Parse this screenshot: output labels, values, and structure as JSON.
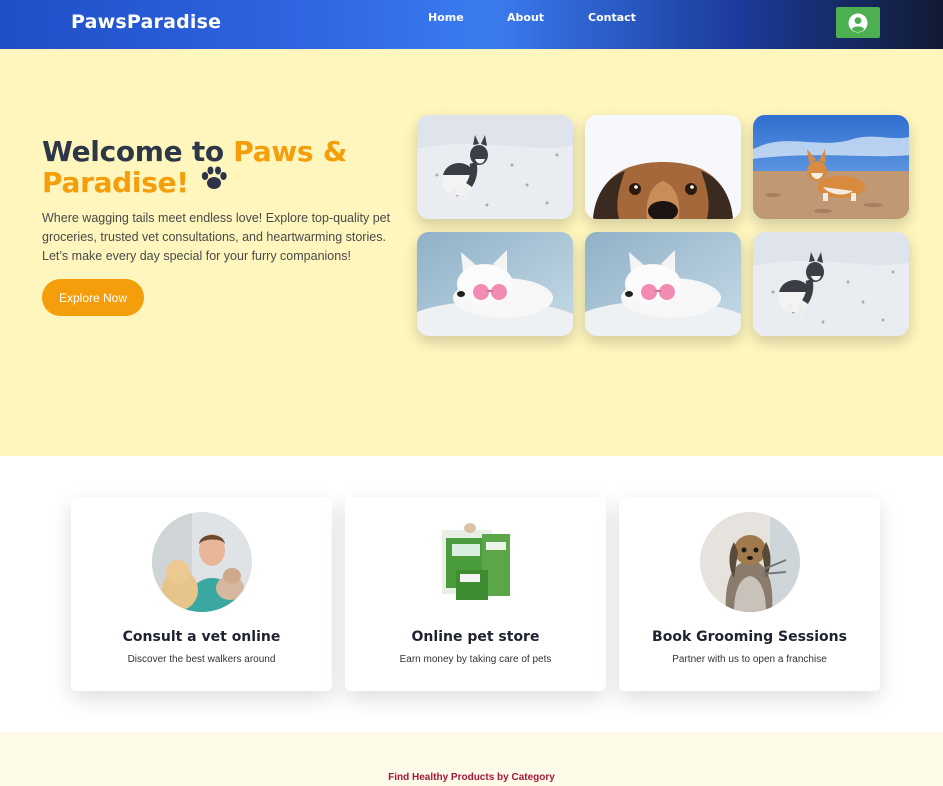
{
  "navbar": {
    "brand": "PawsParadise",
    "links": [
      "Home",
      "About",
      "Contact"
    ],
    "profile_icon": "user-circle-icon",
    "profile_color": "#4caf50"
  },
  "hero": {
    "title_prefix": "Welcome to ",
    "title_accent": "Paws & Paradise!",
    "title_icon": "paw-icon",
    "accent_color": "#f59e0b",
    "description": "Where wagging tails meet endless love! Explore top-quality pet groceries, trusted vet consultations, and heartwarming stories. Let’s make every day special for your furry companions!",
    "cta_label": "Explore Now",
    "background": "#fef6bd"
  },
  "services": [
    {
      "title": "Consult a vet online",
      "description": "Discover the best walkers around"
    },
    {
      "title": "Online pet store",
      "description": "Earn money by taking care of pets"
    },
    {
      "title": "Book Grooming Sessions",
      "description": "Partner with us to open a franchise"
    }
  ],
  "category": {
    "title": "Find Healthy Products by Category",
    "title_color": "#a3183a"
  }
}
